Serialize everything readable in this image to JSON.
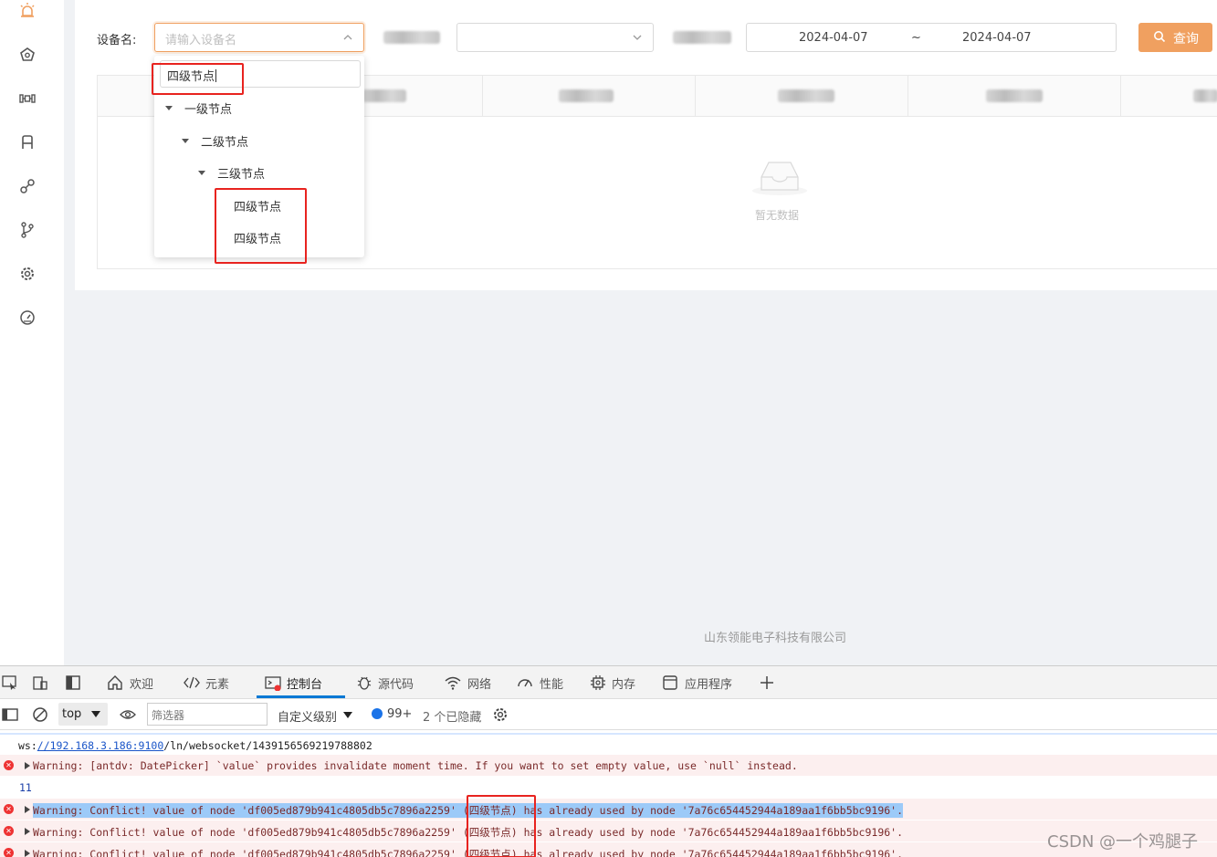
{
  "sidebar": {
    "icons": [
      "alarm-icon",
      "dashboard-pentagon-icon",
      "dumbbell-icon",
      "seat-icon",
      "link-icon",
      "branch-icon",
      "gear-icon",
      "speedometer-icon"
    ],
    "accent": "#f0a060"
  },
  "filters": {
    "device_label": "设备名:",
    "device_placeholder": "请输入设备名",
    "start_date": "2024-04-07",
    "date_sep": "~",
    "end_date": "2024-04-07",
    "query_label": "查询",
    "accent": "#f0a060"
  },
  "tree_dropdown": {
    "search_value": "四级节点",
    "nodes": [
      {
        "label": "一级节点",
        "level": 1,
        "expanded": true
      },
      {
        "label": "二级节点",
        "level": 2,
        "expanded": true
      },
      {
        "label": "三级节点",
        "level": 3,
        "expanded": true
      },
      {
        "label": "四级节点",
        "level": 4
      },
      {
        "label": "四级节点",
        "level": 4
      }
    ],
    "highlight_color": "#e8231f"
  },
  "table": {
    "empty_text": "暂无数据"
  },
  "footer": {
    "company": "山东领能电子科技有限公司"
  },
  "devtools": {
    "tabs": [
      {
        "label": "欢迎",
        "icon": "home-icon"
      },
      {
        "label": "元素",
        "icon": "code-icon"
      },
      {
        "label": "控制台",
        "icon": "console-icon",
        "active": true
      },
      {
        "label": "源代码",
        "icon": "bug-icon"
      },
      {
        "label": "网络",
        "icon": "wifi-icon"
      },
      {
        "label": "性能",
        "icon": "gauge-icon"
      },
      {
        "label": "内存",
        "icon": "chip-icon"
      },
      {
        "label": "应用程序",
        "icon": "app-icon"
      }
    ],
    "toolbar": {
      "context": "top",
      "filter_placeholder": "筛选器",
      "level_label": "自定义级别",
      "message_count": "99+",
      "hidden_count": "2 个已隐藏"
    },
    "console": {
      "ws_prefix": "ws:",
      "ws_link": "//192.168.3.186:9100",
      "ws_rest": "/ln/websocket/1439156569219788802",
      "warning_1": "Warning: [antdv: DatePicker] `value` provides invalidate moment time. If you want to set empty value, use `null` instead.",
      "number_line": "11",
      "conflict_a": "Warning: Conflict! value of node 'df005ed879b941c4805db5c7896a2259' ",
      "conflict_b": "(四级节点)",
      "conflict_c": " has already used by node '7a76c654452944a189aa1f6bb5bc9196'."
    }
  },
  "watermark": "CSDN @一个鸡腿子"
}
